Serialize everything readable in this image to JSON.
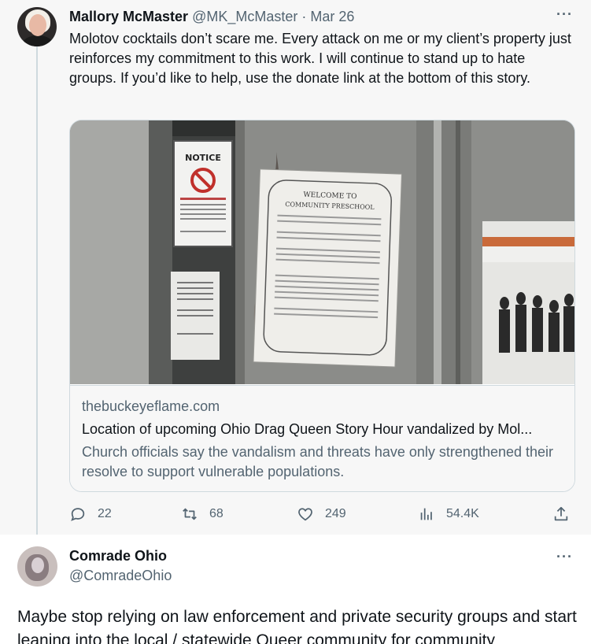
{
  "tweet1": {
    "author_name": "Mallory McMaster",
    "author_handle": "@MK_McMaster",
    "separator": "·",
    "date": "Mar 26",
    "more_label": "···",
    "text": "Molotov cocktails don’t scare me. Every attack on me or my client’s property just reinforces my commitment to this work. I will continue to stand up to hate groups. If you’d like to help, use the donate link at the bottom of this story.",
    "card": {
      "domain": "thebuckeyeflame.com",
      "title": "Location of upcoming Ohio Drag Queen Story Hour vandalized by Mol...",
      "description": "Church officials say the vandalism and threats have only strengthened their resolve to support vulnerable populations.",
      "photo_sign_notice": "NOTICE",
      "photo_sign_welcome": "WELCOME TO",
      "photo_sign_school": "COMMUNITY PRESCHOOL"
    },
    "actions": {
      "replies": "22",
      "retweets": "68",
      "likes": "249",
      "views": "54.4K"
    }
  },
  "tweet2": {
    "author_name": "Comrade Ohio",
    "author_handle": "@ComradeOhio",
    "more_label": "···",
    "text": "Maybe stop relying on law enforcement and private security groups and start leaning into the local / statewide Queer community for community"
  },
  "colors": {
    "text": "#0f1419",
    "muted": "#536471",
    "border": "#cfd9de",
    "background": "#f7f7f7"
  },
  "icons": [
    "reply-icon",
    "retweet-icon",
    "like-icon",
    "views-icon",
    "share-icon",
    "more-icon"
  ]
}
